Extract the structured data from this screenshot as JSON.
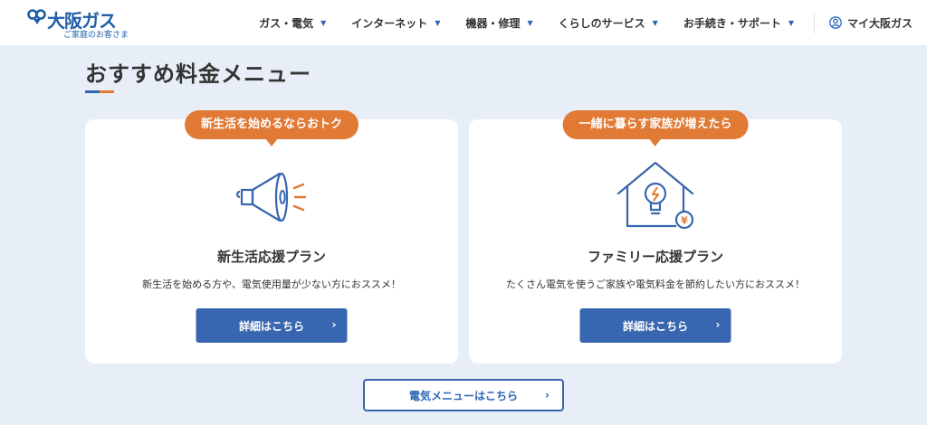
{
  "header": {
    "logo_text": "大阪ガス",
    "logo_sub": "ご家庭のお客さま",
    "nav": [
      {
        "label": "ガス・電気"
      },
      {
        "label": "インターネット"
      },
      {
        "label": "機器・修理"
      },
      {
        "label": "くらしのサービス"
      },
      {
        "label": "お手続き・サポート"
      }
    ],
    "mypage_label": "マイ大阪ガス"
  },
  "section": {
    "title": "おすすめ料金メニュー"
  },
  "cards": [
    {
      "badge": "新生活を始めるならおトク",
      "icon": "megaphone-icon",
      "title": "新生活応援プラン",
      "desc": "新生活を始める方や、電気使用量が少ない方におススメ！",
      "button": "詳細はこちら"
    },
    {
      "badge": "一緒に暮らす家族が増えたら",
      "icon": "house-bulb-icon",
      "title": "ファミリー応援プラン",
      "desc": "たくさん電気を使うご家族や電気料金を節約したい方におススメ！",
      "button": "詳細はこちら"
    }
  ],
  "menu_button": "電気メニューはこちら",
  "colors": {
    "brand_blue": "#2c66b8",
    "button_blue": "#3866b0",
    "accent_orange": "#e07a35",
    "page_bg": "#e8eef7"
  }
}
